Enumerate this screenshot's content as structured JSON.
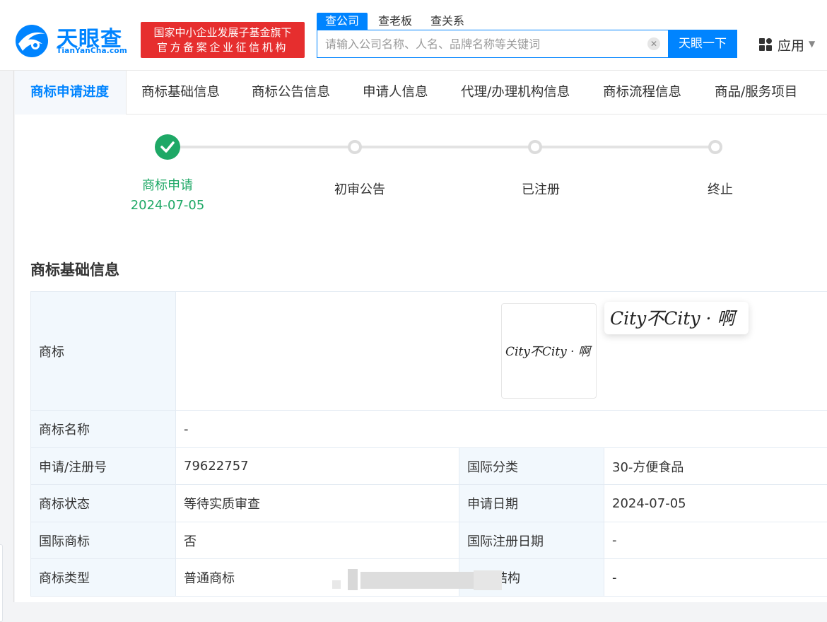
{
  "header": {
    "logo_title": "天眼查",
    "logo_subtitle": "TianYanCha.com",
    "badge_line1": "国家中小企业发展子基金旗下",
    "badge_line2": "官方备案企业征信机构",
    "search_tabs": [
      "查公司",
      "查老板",
      "查关系"
    ],
    "search_placeholder": "请输入公司名称、人名、品牌名称等关键词",
    "search_button": "天眼一下",
    "apps_label": "应用"
  },
  "tabs": [
    "商标申请进度",
    "商标基础信息",
    "商标公告信息",
    "申请人信息",
    "代理/办理机构信息",
    "商标流程信息",
    "商品/服务项目"
  ],
  "progress": {
    "steps": [
      {
        "label": "商标申请",
        "date": "2024-07-05",
        "done": true
      },
      {
        "label": "初审公告"
      },
      {
        "label": "已注册"
      },
      {
        "label": "终止"
      }
    ]
  },
  "basic_info": {
    "title": "商标基础信息",
    "trademark_label": "商标",
    "trademark_image_text": "City不City · 啊",
    "name_label": "商标名称",
    "name_value": "-",
    "rows": [
      {
        "k1": "申请/注册号",
        "v1": "79622757",
        "k2": "国际分类",
        "v2": "30-方便食品"
      },
      {
        "k1": "商标状态",
        "v1": "等待实质审查",
        "k2": "申请日期",
        "v2": "2024-07-05"
      },
      {
        "k1": "国际商标",
        "v1": "否",
        "k2": "国际注册日期",
        "v2": "-"
      },
      {
        "k1": "商标类型",
        "v1": "普通商标",
        "k2": "结构",
        "v2": "-"
      }
    ]
  },
  "colors": {
    "brand_blue": "#0084ff",
    "badge_red": "#e62e2e",
    "success_green": "#1ea866"
  }
}
